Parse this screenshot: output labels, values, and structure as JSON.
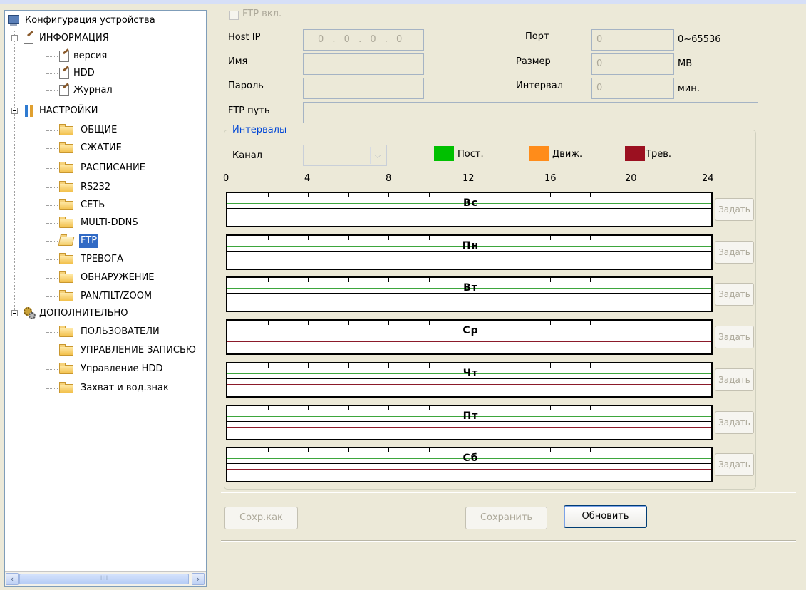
{
  "tree": {
    "root": "Конфигурация устройства",
    "info": {
      "label": "ИНФОРМАЦИЯ",
      "items": [
        "версия",
        "HDD",
        "Журнал"
      ]
    },
    "settings": {
      "label": "НАСТРОЙКИ",
      "items": [
        "ОБЩИЕ",
        "СЖАТИЕ",
        "РАСПИСАНИЕ",
        "RS232",
        "СЕТЬ",
        "MULTI-DDNS",
        "FTP",
        "ТРЕВОГА",
        "ОБНАРУЖЕНИЕ",
        "PAN/TILT/ZOOM"
      ]
    },
    "advanced": {
      "label": "ДОПОЛНИТЕЛЬНО",
      "items": [
        "ПОЛЬЗОВАТЕЛИ",
        "УПРАВЛЕНИЕ ЗАПИСЬЮ",
        "Управление HDD",
        "Захват и вод.знак"
      ]
    },
    "selected": "FTP",
    "scrollbar": {
      "left_arrow": "‹",
      "right_arrow": "›",
      "thumb_grip": "IIII"
    }
  },
  "form": {
    "ftp_enable_label": "FTP вкл.",
    "host_ip_label": "Host IP",
    "host_ip_value": "0 . 0 . 0 . 0",
    "name_label": "Имя",
    "name_value": "",
    "password_label": "Пароль",
    "password_value": "",
    "ftp_path_label": "FTP путь",
    "ftp_path_value": "",
    "port_label": "Порт",
    "port_value": "0",
    "port_range": "0~65536",
    "size_label": "Размер",
    "size_value": "0",
    "size_unit": "MB",
    "interval_label": "Интервал",
    "interval_value": "0",
    "interval_unit": "мин."
  },
  "intervals": {
    "title": "Интервалы",
    "channel_label": "Канал",
    "channel_value": "",
    "legend": [
      {
        "label": "Пост.",
        "color": "#00c000"
      },
      {
        "label": "Движ.",
        "color": "#ff8c1a"
      },
      {
        "label": "Трев.",
        "color": "#9b1020"
      }
    ],
    "hours": [
      "0",
      "4",
      "8",
      "12",
      "16",
      "20",
      "24"
    ],
    "days": [
      "Вс",
      "Пн",
      "Вт",
      "Ср",
      "Чт",
      "Пт",
      "Сб"
    ],
    "set_button": "Задать"
  },
  "buttons": {
    "save_as": "Сохр.как",
    "save": "Сохранить",
    "refresh": "Обновить"
  }
}
